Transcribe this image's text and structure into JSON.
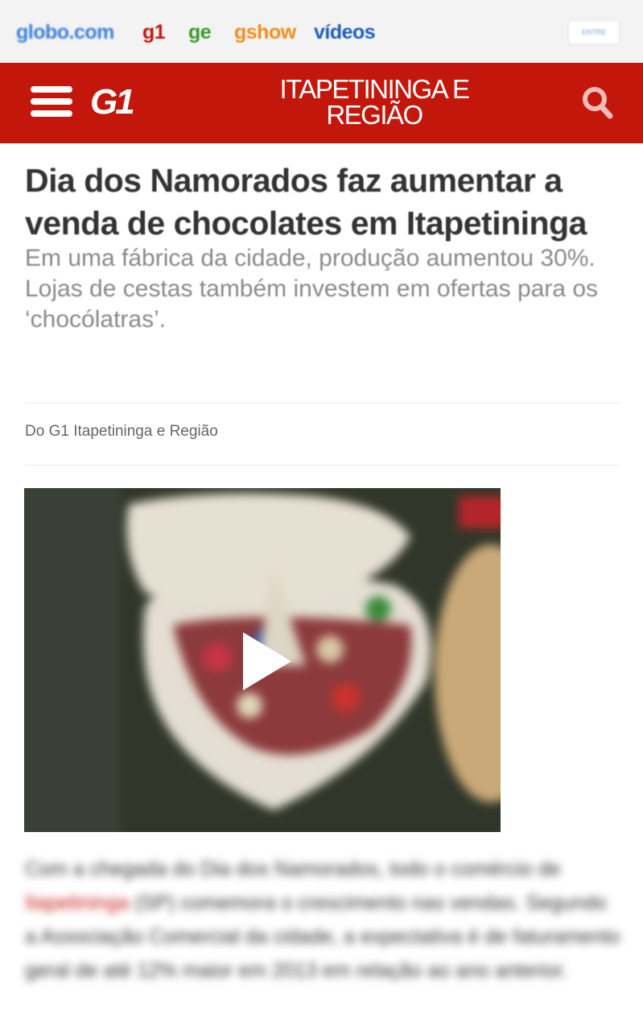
{
  "top_nav": {
    "globo": "globo.com",
    "g1": "g1",
    "ge": "ge",
    "gshow": "gshow",
    "videos": "vídeos",
    "login": "ENTRE"
  },
  "header": {
    "logo": "G1",
    "region": "ITAPETININGA E REGIÃO",
    "menu_icon": "hamburger-menu-icon",
    "search_icon": "search-icon"
  },
  "article": {
    "title": "Dia dos Namorados faz aumentar a venda de chocolates em Itapetininga",
    "subtitle": "Em uma fábrica da cidade, produção aumentou 30%. Lojas de cestas também investem em ofertas para os ‘chocólatras’.",
    "byline": "Do G1 Itapetininga e Região",
    "body_start": "Com a chegada do Dia dos Namorados, todo o comércio de ",
    "body_link": "Itapetininga",
    "body_end": " (SP) comemora o crescimento nas vendas. Segundo a Associação Comercial da cidade, a expectativa é de faturamento geral de até 12% maior em 2013 em relação ao ano anterior."
  },
  "colors": {
    "brand_red": "#c4170c",
    "title_text": "#333333",
    "subtitle_text": "#8a8a8a"
  }
}
